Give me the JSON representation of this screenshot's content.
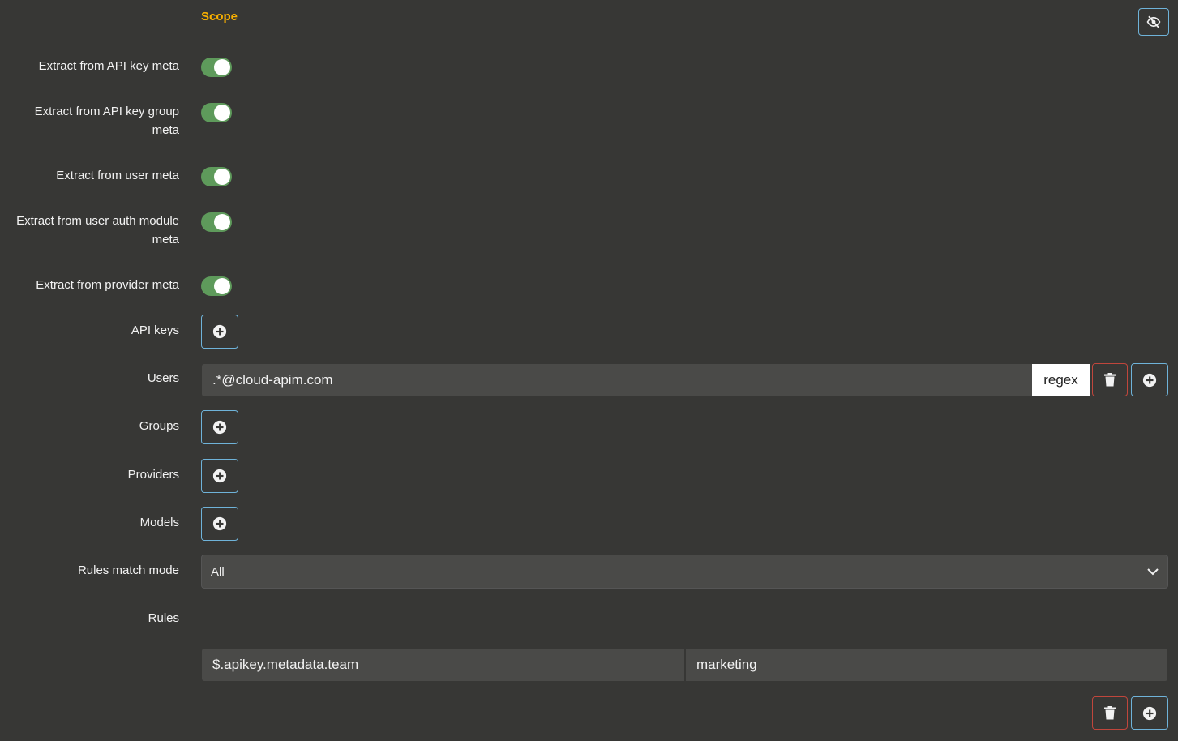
{
  "section": {
    "title": "Scope"
  },
  "toggles": [
    {
      "label_line1": "Extract from API key meta",
      "label_line2": "",
      "on": true
    },
    {
      "label_line1": "Extract from API key group",
      "label_line2": "meta",
      "on": true
    },
    {
      "label_line1": "Extract from user meta",
      "label_line2": "",
      "on": true
    },
    {
      "label_line1": "Extract from user auth module",
      "label_line2": "meta",
      "on": true
    },
    {
      "label_line1": "Extract from provider meta",
      "label_line2": "",
      "on": true
    }
  ],
  "fields": {
    "api_keys": {
      "label": "API keys"
    },
    "users": {
      "label": "Users",
      "value": ".*@cloud-apim.com",
      "addon": "regex"
    },
    "groups": {
      "label": "Groups"
    },
    "providers": {
      "label": "Providers"
    },
    "models": {
      "label": "Models"
    },
    "rules_match_mode": {
      "label": "Rules match mode",
      "selected": "All"
    },
    "rules": {
      "label": "Rules",
      "key": "$.apikey.metadata.team",
      "value": "marketing"
    }
  },
  "icons": {
    "hide": "eye-slash-icon",
    "add": "plus-circle-icon",
    "delete": "trash-icon",
    "dropdown": "chevron-down-icon"
  },
  "colors": {
    "background": "#373735",
    "accent": "#f9b000",
    "toggle_on": "#5e9a5b",
    "button_border": "#6fb3d9",
    "danger_border": "#c0463c",
    "input_bg": "#4a4a48"
  }
}
